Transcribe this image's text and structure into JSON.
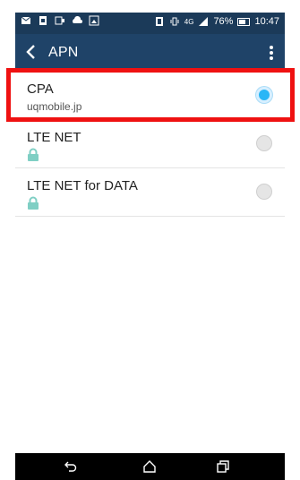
{
  "status_bar": {
    "battery_percent": "76%",
    "time": "10:47",
    "network": "4G"
  },
  "app_bar": {
    "title": "APN"
  },
  "apn_list": [
    {
      "name": "CPA",
      "subtitle": "uqmobile.jp",
      "selected": true,
      "locked": false
    },
    {
      "name": "LTE NET",
      "subtitle": "",
      "selected": false,
      "locked": true
    },
    {
      "name": "LTE NET for DATA",
      "subtitle": "",
      "selected": false,
      "locked": true
    }
  ],
  "colors": {
    "status_bar": "#1b3a59",
    "app_bar": "#1f4368",
    "radio_selected": "#29b6f6",
    "lock_icon": "#7fcfc4",
    "highlight_box": "#ef1111"
  },
  "icons": {
    "back": "back-arrow-icon",
    "overflow": "overflow-menu-icon",
    "nav_back": "nav-back-icon",
    "nav_home": "nav-home-icon",
    "nav_recents": "nav-recents-icon"
  }
}
